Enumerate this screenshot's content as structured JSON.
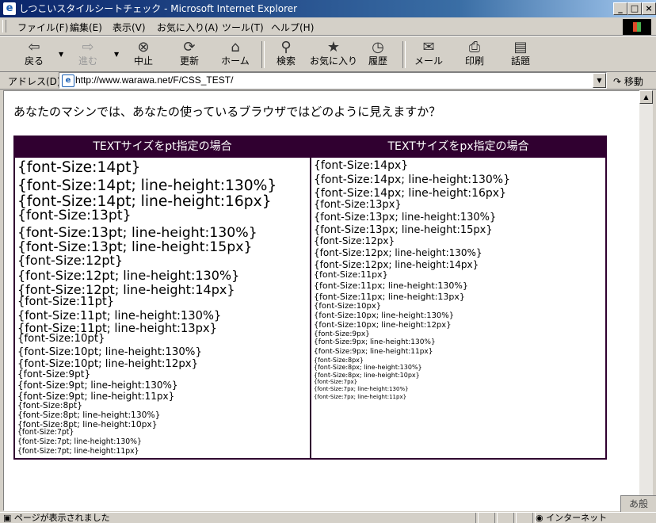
{
  "window": {
    "title": "しつこいスタイルシートチェック - Microsoft Internet Explorer",
    "controls": [
      "_",
      "□",
      "×"
    ]
  },
  "menu": {
    "items": [
      "ファイル(F)",
      "編集(E)",
      "表示(V)",
      "お気に入り(A)",
      "ツール(T)",
      "ヘルプ(H)"
    ]
  },
  "toolbar": {
    "buttons": [
      {
        "label": "戻る",
        "icon": "back-arrow-icon",
        "glyph": "⇦"
      },
      {
        "label": "進む",
        "icon": "forward-arrow-icon",
        "glyph": "⇨"
      },
      {
        "label": "中止",
        "icon": "stop-icon",
        "glyph": "⊗"
      },
      {
        "label": "更新",
        "icon": "refresh-icon",
        "glyph": "⟳"
      },
      {
        "label": "ホーム",
        "icon": "home-icon",
        "glyph": "⌂"
      },
      {
        "label": "検索",
        "icon": "search-icon",
        "glyph": "⚲"
      },
      {
        "label": "お気に入り",
        "icon": "favorites-icon",
        "glyph": "★"
      },
      {
        "label": "履歴",
        "icon": "history-icon",
        "glyph": "◷"
      },
      {
        "label": "メール",
        "icon": "mail-icon",
        "glyph": "✉"
      },
      {
        "label": "印刷",
        "icon": "print-icon",
        "glyph": "⎙"
      },
      {
        "label": "話題",
        "icon": "discuss-icon",
        "glyph": "▤"
      }
    ]
  },
  "address": {
    "label": "アドレス(D)",
    "url": "http://www.warawa.net/F/CSS_TEST/",
    "go_label": "移動"
  },
  "page": {
    "question": "あなたのマシンでは、あなたの使っているブラウザではどのように見えますか？",
    "pt_header": "TEXTサイズをpt指定の場合",
    "px_header": "TEXTサイズをpx指定の場合",
    "pt_lines": [
      {
        "text": "{font-Size:14pt}",
        "size": 14,
        "lh": null
      },
      {
        "text": "{font-Size:14pt; line-height:130%}",
        "size": 14,
        "lh": 1.3
      },
      {
        "text": "{font-Size:14pt; line-height:16px}",
        "size": 14,
        "lh": 16
      },
      {
        "text": "{font-Size:13pt}",
        "size": 13,
        "lh": null
      },
      {
        "text": "{font-Size:13pt; line-height:130%}",
        "size": 13,
        "lh": 1.3
      },
      {
        "text": "{font-Size:13pt; line-height:15px}",
        "size": 13,
        "lh": 15
      },
      {
        "text": "{font-Size:12pt}",
        "size": 12,
        "lh": null
      },
      {
        "text": "{font-Size:12pt; line-height:130%}",
        "size": 12,
        "lh": 1.3
      },
      {
        "text": "{font-Size:12pt; line-height:14px}",
        "size": 12,
        "lh": 14
      },
      {
        "text": "{font-Size:11pt}",
        "size": 11,
        "lh": null
      },
      {
        "text": "{font-Size:11pt; line-height:130%}",
        "size": 11,
        "lh": 1.3
      },
      {
        "text": "{font-Size:11pt; line-height:13px}",
        "size": 11,
        "lh": 13
      },
      {
        "text": "{font-Size:10pt}",
        "size": 10,
        "lh": null
      },
      {
        "text": "{font-Size:10pt; line-height:130%}",
        "size": 10,
        "lh": 1.3
      },
      {
        "text": "{font-Size:10pt; line-height:12px}",
        "size": 10,
        "lh": 12
      },
      {
        "text": "{font-Size:9pt}",
        "size": 9,
        "lh": null
      },
      {
        "text": "{font-Size:9pt; line-height:130%}",
        "size": 9,
        "lh": 1.3
      },
      {
        "text": "{font-Size:9pt; line-height:11px}",
        "size": 9,
        "lh": 11
      },
      {
        "text": "{font-Size:8pt}",
        "size": 8,
        "lh": null
      },
      {
        "text": "{font-Size:8pt; line-height:130%}",
        "size": 8,
        "lh": 1.3
      },
      {
        "text": "{font-Size:8pt; line-height:10px}",
        "size": 8,
        "lh": 10
      },
      {
        "text": "{font-Size:7pt}",
        "size": 7,
        "lh": null
      },
      {
        "text": "{font-Size:7pt; line-height:130%}",
        "size": 7,
        "lh": 1.3
      },
      {
        "text": "{font-Size:7pt; line-height:11px}",
        "size": 7,
        "lh": 11
      }
    ],
    "px_lines": [
      {
        "text": "{font-Size:14px}",
        "size": 14,
        "lh": null
      },
      {
        "text": "{font-Size:14px; line-height:130%}",
        "size": 14,
        "lh": 1.3
      },
      {
        "text": "{font-Size:14px; line-height:16px}",
        "size": 14,
        "lh": 16
      },
      {
        "text": "{font-Size:13px}",
        "size": 13,
        "lh": null
      },
      {
        "text": "{font-Size:13px; line-height:130%}",
        "size": 13,
        "lh": 1.3
      },
      {
        "text": "{font-Size:13px; line-height:15px}",
        "size": 13,
        "lh": 15
      },
      {
        "text": "{font-Size:12px}",
        "size": 12,
        "lh": null
      },
      {
        "text": "{font-Size:12px; line-height:130%}",
        "size": 12,
        "lh": 1.3
      },
      {
        "text": "{font-Size:12px; line-height:14px}",
        "size": 12,
        "lh": 14
      },
      {
        "text": "{font-Size:11px}",
        "size": 11,
        "lh": null
      },
      {
        "text": "{font-Size:11px; line-height:130%}",
        "size": 11,
        "lh": 1.3
      },
      {
        "text": "{font-Size:11px; line-height:13px}",
        "size": 11,
        "lh": 13
      },
      {
        "text": "{font-Size:10px}",
        "size": 10,
        "lh": null
      },
      {
        "text": "{font-Size:10px; line-height:130%}",
        "size": 10,
        "lh": 1.3
      },
      {
        "text": "{font-Size:10px; line-height:12px}",
        "size": 10,
        "lh": 12
      },
      {
        "text": "{font-Size:9px}",
        "size": 9,
        "lh": null
      },
      {
        "text": "{font-Size:9px; line-height:130%}",
        "size": 9,
        "lh": 1.3
      },
      {
        "text": "{font-Size:9px; line-height:11px}",
        "size": 9,
        "lh": 11
      },
      {
        "text": "{font-Size:8px}",
        "size": 8,
        "lh": null
      },
      {
        "text": "{font-Size:8px; line-height:130%}",
        "size": 8,
        "lh": 1.3
      },
      {
        "text": "{font-Size:8px; line-height:10px}",
        "size": 8,
        "lh": 10
      },
      {
        "text": "{font-Size:7px}",
        "size": 7,
        "lh": null
      },
      {
        "text": "{font-Size:7px; line-height:130%}",
        "size": 7,
        "lh": 1.3
      },
      {
        "text": "{font-Size:7px; line-height:11px}",
        "size": 7,
        "lh": 11
      }
    ]
  },
  "status": {
    "text": "ページが表示されました",
    "zone": "インターネット"
  },
  "ime": {
    "label": "あ般"
  },
  "colors": {
    "table_header_bg": "#300030",
    "title_bar": "#0a246a"
  }
}
